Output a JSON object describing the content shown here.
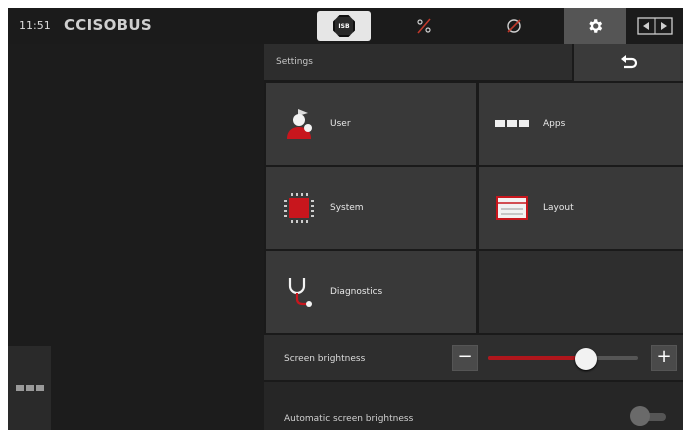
{
  "topbar": {
    "clock": "11:51",
    "brand": "CCISOBUS",
    "isb_label": "ISB"
  },
  "panel": {
    "title": "Settings",
    "tiles": [
      {
        "label": "User",
        "icon": "user-icon"
      },
      {
        "label": "Apps",
        "icon": "apps-grid-icon"
      },
      {
        "label": "System",
        "icon": "chip-icon"
      },
      {
        "label": "Layout",
        "icon": "layout-icon"
      },
      {
        "label": "Diagnostics",
        "icon": "stethoscope-icon"
      }
    ]
  },
  "brightness": {
    "label": "Screen brightness",
    "minus": "−",
    "plus": "+",
    "value_fraction": 0.65
  },
  "auto_brightness": {
    "label": "Automatic screen brightness",
    "enabled": false
  },
  "colors": {
    "accent_red": "#b0161c",
    "active_button": "#555555"
  }
}
